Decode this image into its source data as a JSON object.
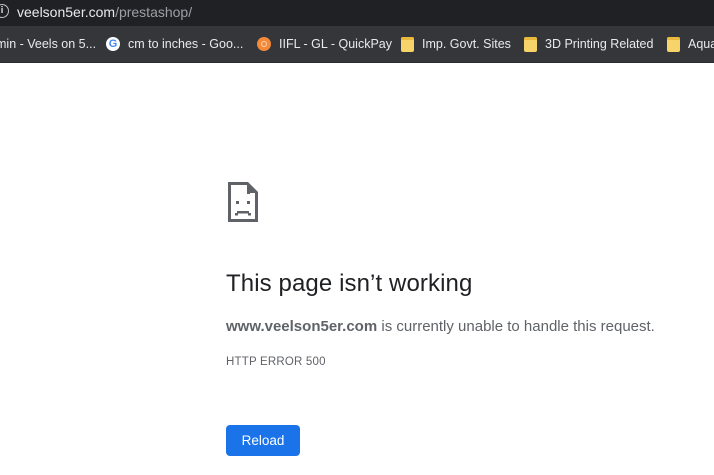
{
  "browser": {
    "url_host": "veelson5er.com",
    "url_path": "/prestashop/",
    "bookmarks": [
      {
        "label": "min - Veels on 5...",
        "icon": "folder-icon"
      },
      {
        "label": "cm to inches - Goo...",
        "icon": "google-icon"
      },
      {
        "label": "IIFL - GL - QuickPay",
        "icon": "iifl-icon"
      },
      {
        "label": "Imp. Govt. Sites",
        "icon": "folder-icon"
      },
      {
        "label": "3D Printing Related",
        "icon": "folder-icon"
      },
      {
        "label": "Aqua",
        "icon": "folder-icon"
      }
    ]
  },
  "error_page": {
    "icon": "sad-page-icon",
    "headline": "This page isn’t working",
    "domain": "www.veelson5er.com",
    "message_rest": " is currently unable to handle this request.",
    "error_code": "HTTP ERROR 500",
    "reload_label": "Reload"
  },
  "colors": {
    "address_bar_bg": "#202124",
    "bookmarks_bar_bg": "#35363a",
    "reload_button": "#1a73e8"
  }
}
